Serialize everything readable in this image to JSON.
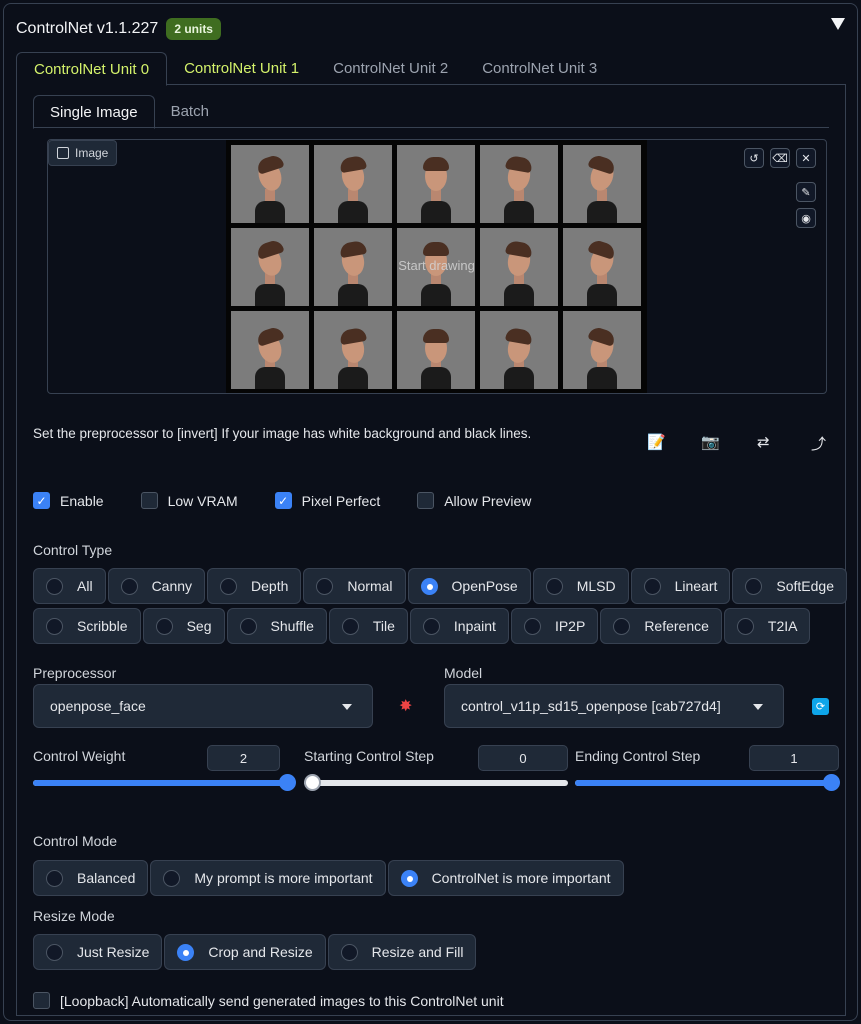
{
  "header": {
    "title": "ControlNet v1.1.227",
    "badge": "2 units"
  },
  "unit_tabs": [
    "ControlNet Unit 0",
    "ControlNet Unit 1",
    "ControlNet Unit 2",
    "ControlNet Unit 3"
  ],
  "image_tabs": [
    "Single Image",
    "Batch"
  ],
  "image_panel": {
    "label": "Image",
    "overlay_text": "Start drawing"
  },
  "hint": "Set the preprocessor to [invert] If your image has white background and black lines.",
  "checkboxes": [
    {
      "label": "Enable",
      "checked": true
    },
    {
      "label": "Low VRAM",
      "checked": false
    },
    {
      "label": "Pixel Perfect",
      "checked": true
    },
    {
      "label": "Allow Preview",
      "checked": false
    }
  ],
  "control_type": {
    "label": "Control Type",
    "row1": [
      "All",
      "Canny",
      "Depth",
      "Normal",
      "OpenPose",
      "MLSD",
      "Lineart",
      "SoftEdge"
    ],
    "row2": [
      "Scribble",
      "Seg",
      "Shuffle",
      "Tile",
      "Inpaint",
      "IP2P",
      "Reference",
      "T2IA"
    ],
    "selected": "OpenPose"
  },
  "preprocessor": {
    "label": "Preprocessor",
    "value": "openpose_face"
  },
  "model": {
    "label": "Model",
    "value": "control_v11p_sd15_openpose [cab727d4]"
  },
  "sliders": {
    "control_weight": {
      "label": "Control Weight",
      "value": "2"
    },
    "starting_step": {
      "label": "Starting Control Step",
      "value": "0"
    },
    "ending_step": {
      "label": "Ending Control Step",
      "value": "1"
    }
  },
  "control_mode": {
    "label": "Control Mode",
    "options": [
      "Balanced",
      "My prompt is more important",
      "ControlNet is more important"
    ],
    "selected": "ControlNet is more important"
  },
  "resize_mode": {
    "label": "Resize Mode",
    "options": [
      "Just Resize",
      "Crop and Resize",
      "Resize and Fill"
    ],
    "selected": "Crop and Resize"
  },
  "loopback": {
    "label": "[Loopback] Automatically send generated images to this ControlNet unit",
    "checked": false
  },
  "colors": {
    "accent": "#3b82f6",
    "tab_active": "#d4f26b",
    "badge": "#3f6d20"
  }
}
